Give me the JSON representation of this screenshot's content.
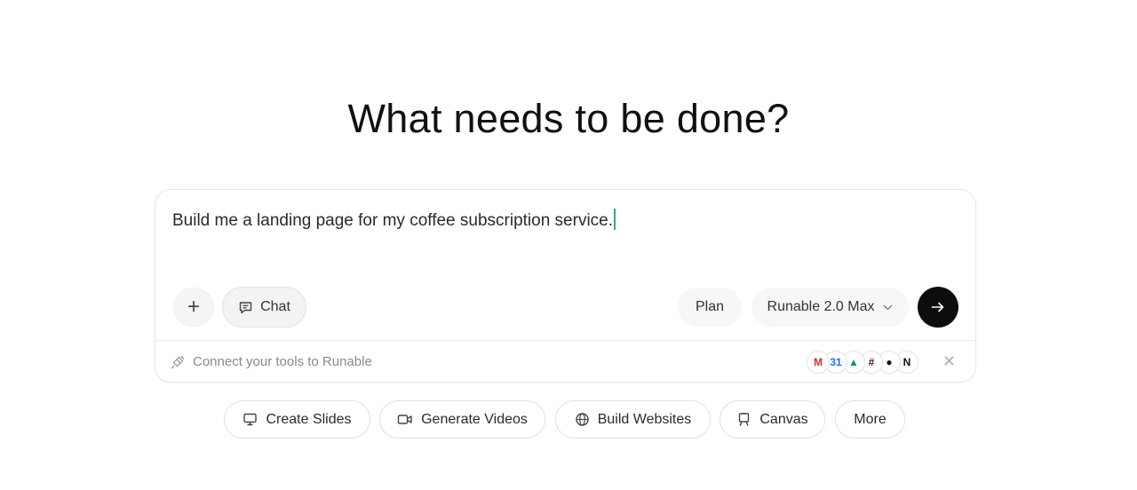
{
  "heading": "What needs to be done?",
  "composer": {
    "prompt_value": "Build me a landing page for my coffee subscription service.",
    "add_label": "+",
    "mode_label": "Chat",
    "plan_label": "Plan",
    "model_label": "Runable 2.0 Max"
  },
  "connect": {
    "text": "Connect your tools to Runable",
    "close": "✕",
    "tools": [
      {
        "name": "gmail",
        "glyph": "M",
        "color": "#d93025"
      },
      {
        "name": "google-calendar",
        "glyph": "31",
        "color": "#1a73e8"
      },
      {
        "name": "google-drive",
        "glyph": "▲",
        "color": "#0f9d58"
      },
      {
        "name": "slack",
        "glyph": "#",
        "color": "#4a154b"
      },
      {
        "name": "github",
        "glyph": "●",
        "color": "#111111"
      },
      {
        "name": "notion",
        "glyph": "N",
        "color": "#111111"
      }
    ]
  },
  "quick_actions": [
    {
      "label": "Create Slides",
      "icon": "monitor-icon"
    },
    {
      "label": "Generate Videos",
      "icon": "video-icon"
    },
    {
      "label": "Build Websites",
      "icon": "globe-icon"
    },
    {
      "label": "Canvas",
      "icon": "easel-icon"
    },
    {
      "label": "More",
      "icon": ""
    }
  ]
}
